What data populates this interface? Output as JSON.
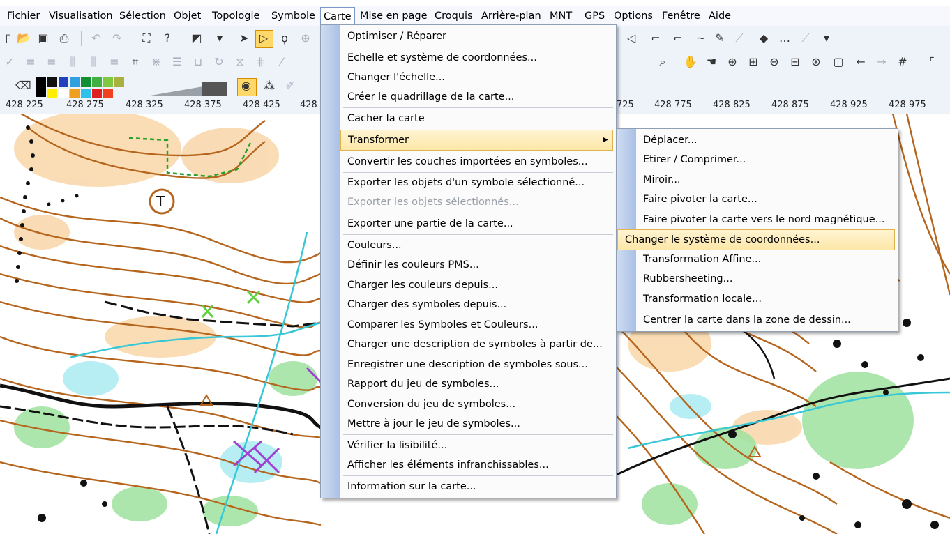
{
  "menubar": [
    "Fichier",
    "Visualisation",
    "Sélection",
    "Objet",
    "Topologie",
    "Symbole",
    "Carte",
    "Mise en page",
    "Croquis",
    "Arrière-plan",
    "MNT",
    "GPS",
    "Options",
    "Fenêtre",
    "Aide"
  ],
  "ruler_ticks": [
    "428 225",
    "428 275",
    "428 325",
    "428 375",
    "428 425",
    "428",
    "725",
    "428 775",
    "428 825",
    "428 875",
    "428 925",
    "428 975"
  ],
  "carte_menu": {
    "items": [
      "Optimiser / Réparer",
      "Echelle et système de coordonnées...",
      "Changer l'échelle...",
      "Créer le quadrillage de la carte...",
      "Cacher la carte",
      "Transformer",
      "Convertir les couches importées en symboles...",
      "Exporter les objets d'un symbole sélectionné...",
      "Exporter les objets sélectionnés...",
      "Exporter une partie de la carte...",
      "Couleurs...",
      "Définir les couleurs PMS...",
      "Charger les couleurs depuis...",
      "Charger des symboles depuis...",
      "Comparer les Symboles et Couleurs...",
      "Charger une description de symboles à partir de...",
      "Enregistrer une description de symboles sous...",
      "Rapport du jeu de symboles...",
      "Conversion du jeu de symboles...",
      "Mettre à jour le jeu de symboles...",
      "Vérifier la lisibilité...",
      "Afficher les éléments infranchissables...",
      "Information sur la carte..."
    ]
  },
  "transformer_menu": {
    "items": [
      "Déplacer...",
      "Etirer / Comprimer...",
      "Miroir...",
      "Faire pivoter la carte...",
      "Faire pivoter la carte vers le nord magnétique...",
      "Changer le système de coordonnées...",
      "Transformation Affine...",
      "Rubbersheeting...",
      "Transformation locale...",
      "Centrer la carte dans la zone de dessin..."
    ]
  },
  "toolbar_icons": [
    "new-icon",
    "open-icon",
    "save-icon",
    "print-icon",
    "undo-icon",
    "redo-icon",
    "fullscreen-icon",
    "help-icon",
    "arrow-select-icon",
    "node-select-icon",
    "lasso-icon",
    "hand-icon",
    "zoom-in-icon",
    "zoom-out-icon",
    "back-icon",
    "forward-icon",
    "grid-icon",
    "eye-icon"
  ],
  "colors": {
    "highlight_bg": "#fde7a8",
    "map_brown": "#b5651d",
    "map_orange": "#f7c98e",
    "map_green": "#8bd68b",
    "map_cyan": "#3cc8d8",
    "map_violet": "#a040d0"
  }
}
